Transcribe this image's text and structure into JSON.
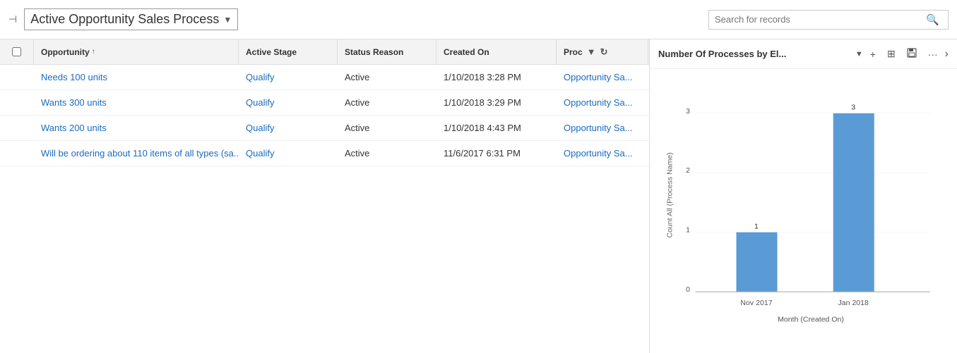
{
  "header": {
    "icon": "→",
    "title": "Active Opportunity Sales Process",
    "dropdown_arrow": "▼",
    "search_placeholder": "Search for records",
    "search_icon": "🔍"
  },
  "table": {
    "columns": [
      {
        "id": "opportunity",
        "label": "Opportunity",
        "sort": "↑"
      },
      {
        "id": "active_stage",
        "label": "Active Stage"
      },
      {
        "id": "status_reason",
        "label": "Status Reason"
      },
      {
        "id": "created_on",
        "label": "Created On"
      },
      {
        "id": "process",
        "label": "Proc"
      }
    ],
    "rows": [
      {
        "opportunity": "Needs 100 units",
        "active_stage": "Qualify",
        "status_reason": "Active",
        "created_on": "1/10/2018 3:28 PM",
        "process": "Opportunity Sa..."
      },
      {
        "opportunity": "Wants 300 units",
        "active_stage": "Qualify",
        "status_reason": "Active",
        "created_on": "1/10/2018 3:29 PM",
        "process": "Opportunity Sa..."
      },
      {
        "opportunity": "Wants 200 units",
        "active_stage": "Qualify",
        "status_reason": "Active",
        "created_on": "1/10/2018 4:43 PM",
        "process": "Opportunity Sa..."
      },
      {
        "opportunity": "Will be ordering about 110 items of all types (sa...",
        "active_stage": "Qualify",
        "status_reason": "Active",
        "created_on": "11/6/2017 6:31 PM",
        "process": "Opportunity Sa..."
      }
    ]
  },
  "chart": {
    "title": "Number Of Processes by El...",
    "y_axis_label": "Count All (Process Name)",
    "x_axis_label": "Month (Created On)",
    "bars": [
      {
        "label": "Nov 2017",
        "value": 1
      },
      {
        "label": "Jan 2018",
        "value": 3
      }
    ],
    "y_max": 3,
    "actions": {
      "add": "+",
      "layout": "⊞",
      "save": "💾",
      "more": "•••"
    }
  }
}
